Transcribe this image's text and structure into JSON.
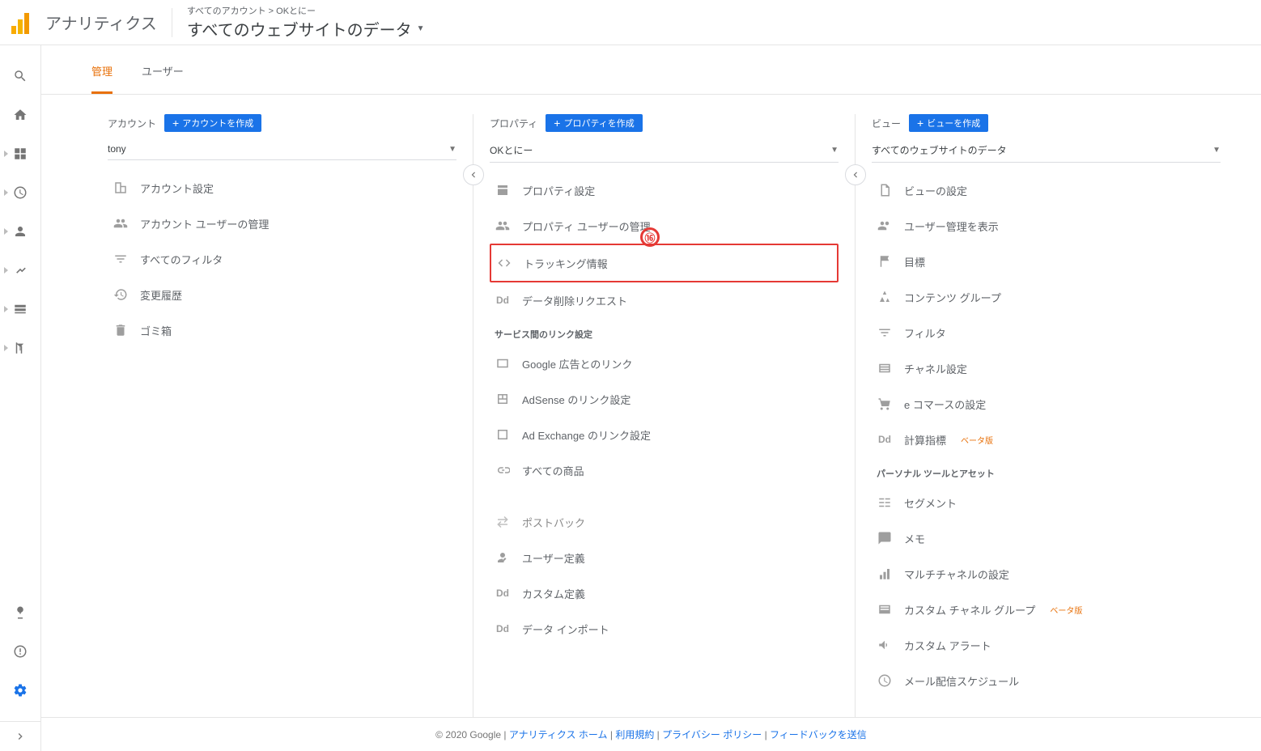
{
  "header": {
    "app_title": "アナリティクス",
    "breadcrumb": "すべてのアカウント > OKとにー",
    "view_name": "すべてのウェブサイトのデータ"
  },
  "tabs": {
    "admin": "管理",
    "users": "ユーザー"
  },
  "account": {
    "heading": "アカウント",
    "create_btn": "アカウントを作成",
    "selected": "tony",
    "items": {
      "settings": "アカウント設定",
      "users": "アカウント ユーザーの管理",
      "filters": "すべてのフィルタ",
      "history": "変更履歴",
      "trash": "ゴミ箱"
    }
  },
  "property": {
    "heading": "プロパティ",
    "create_btn": "プロパティを作成",
    "selected": "OKとにー",
    "items": {
      "settings": "プロパティ設定",
      "users": "プロパティ ユーザーの管理",
      "tracking": "トラッキング情報",
      "delete_req": "データ削除リクエスト"
    },
    "link_section": "サービス間のリンク設定",
    "links": {
      "google_ads": "Google 広告とのリンク",
      "adsense": "AdSense のリンク設定",
      "adexchange": "Ad Exchange のリンク設定",
      "products": "すべての商品"
    },
    "extras": {
      "postback": "ポストバック",
      "user_def": "ユーザー定義",
      "custom_def": "カスタム定義",
      "data_import": "データ インポート"
    }
  },
  "view": {
    "heading": "ビュー",
    "create_btn": "ビューを作成",
    "selected": "すべてのウェブサイトのデータ",
    "items": {
      "settings": "ビューの設定",
      "users": "ユーザー管理を表示",
      "goals": "目標",
      "content_groups": "コンテンツ グループ",
      "filters": "フィルタ",
      "channel": "チャネル設定",
      "ecom": "e コマースの設定",
      "calc_metrics": "計算指標",
      "calc_metrics_beta": "ベータ版"
    },
    "tools_section": "パーソナル ツールとアセット",
    "tools": {
      "segments": "セグメント",
      "notes": "メモ",
      "multichannel": "マルチチャネルの設定",
      "custom_channel": "カスタム チャネル グループ",
      "custom_channel_beta": "ベータ版",
      "alerts": "カスタム アラート",
      "mail_sched": "メール配信スケジュール"
    }
  },
  "annotation": "⑯",
  "footer": {
    "copy": "© 2020 Google",
    "home": "アナリティクス ホーム",
    "terms": "利用規約",
    "privacy": "プライバシー ポリシー",
    "feedback": "フィードバックを送信",
    "sep": " | "
  }
}
